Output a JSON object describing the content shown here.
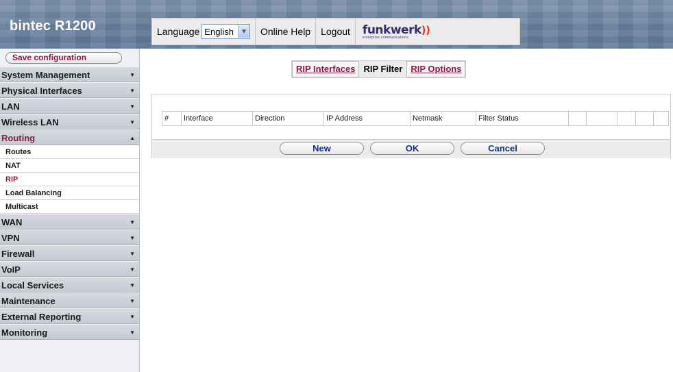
{
  "header": {
    "product_title": "bintec R1200",
    "language_label": "Language",
    "language_value": "English",
    "online_help": "Online Help",
    "logout": "Logout",
    "logo_text": "funkwerk",
    "logo_subtitle": "enterprise communications"
  },
  "sidebar": {
    "save_label": "Save configuration",
    "sections": [
      {
        "label": "System Management"
      },
      {
        "label": "Physical Interfaces"
      },
      {
        "label": "LAN"
      },
      {
        "label": "Wireless LAN"
      },
      {
        "label": "Routing",
        "open": true,
        "items": [
          "Routes",
          "NAT",
          "RIP",
          "Load Balancing",
          "Multicast"
        ],
        "active_item": "RIP"
      },
      {
        "label": "WAN"
      },
      {
        "label": "VPN"
      },
      {
        "label": "Firewall"
      },
      {
        "label": "VoIP"
      },
      {
        "label": "Local Services"
      },
      {
        "label": "Maintenance"
      },
      {
        "label": "External Reporting"
      },
      {
        "label": "Monitoring"
      }
    ]
  },
  "tabs": [
    {
      "label": "RIP Interfaces",
      "current": false
    },
    {
      "label": "RIP Filter",
      "current": true
    },
    {
      "label": "RIP Options",
      "current": false
    }
  ],
  "table": {
    "columns": [
      "#",
      "Interface",
      "Direction",
      "IP Address",
      "Netmask",
      "Filter Status",
      "",
      "",
      "",
      "",
      ""
    ],
    "rows": []
  },
  "buttons": {
    "new": "New",
    "ok": "OK",
    "cancel": "Cancel"
  },
  "colors": {
    "accent": "#8a1a43",
    "button_text": "#1b2f7a",
    "header_bg": "#6d83a1"
  }
}
